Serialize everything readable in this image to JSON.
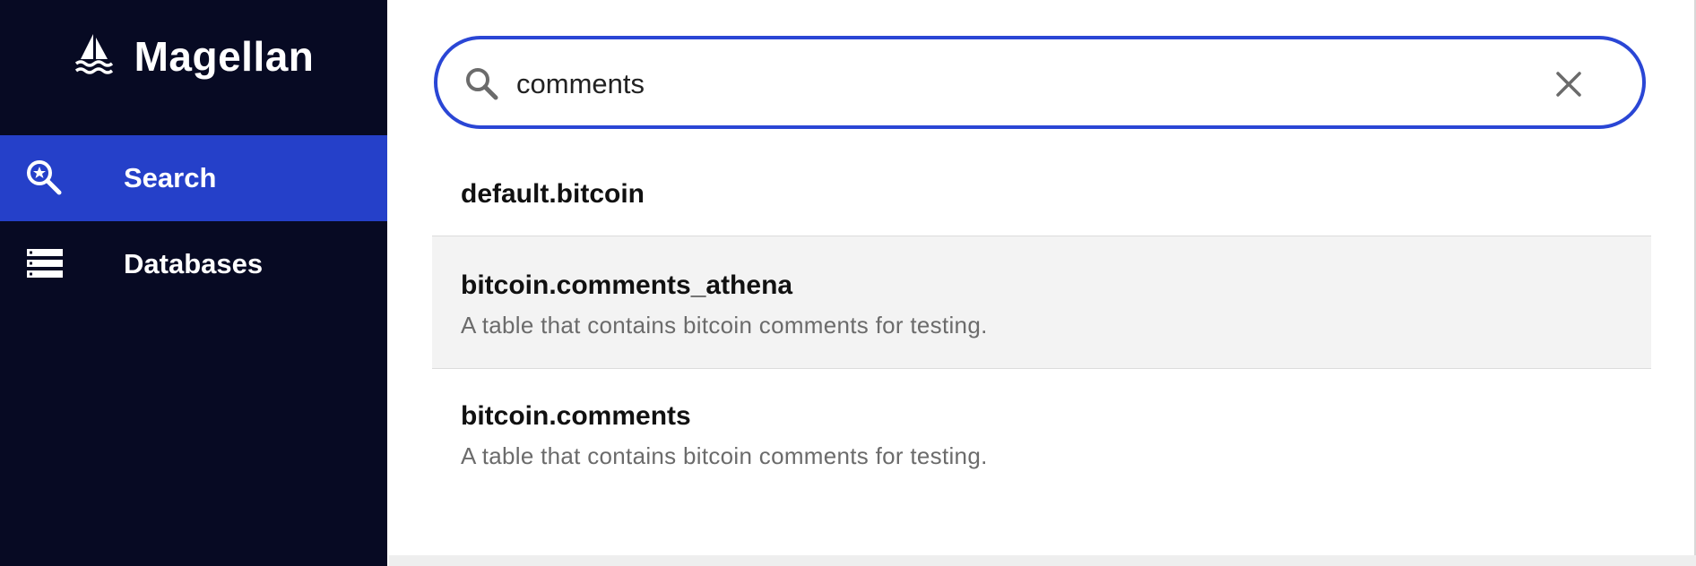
{
  "app": {
    "title": "Magellan",
    "logo_icon": "sailboat-icon"
  },
  "sidebar": {
    "items": [
      {
        "label": "Search",
        "icon": "search-star-icon",
        "active": true
      },
      {
        "label": "Databases",
        "icon": "database-list-icon",
        "active": false
      }
    ]
  },
  "search": {
    "value": "comments",
    "placeholder": "",
    "icon": "search-icon",
    "clear_icon": "close-icon"
  },
  "results": [
    {
      "name": "default.bitcoin",
      "description": ""
    },
    {
      "name": "bitcoin.comments_athena",
      "description": "A table that contains bitcoin comments for testing."
    },
    {
      "name": "bitcoin.comments",
      "description": "A table that contains bitcoin comments for testing."
    }
  ],
  "colors": {
    "sidebar_bg": "#070a23",
    "accent": "#2540c9",
    "search_border": "#2a46d5",
    "highlight_row": "#f3f3f3"
  }
}
